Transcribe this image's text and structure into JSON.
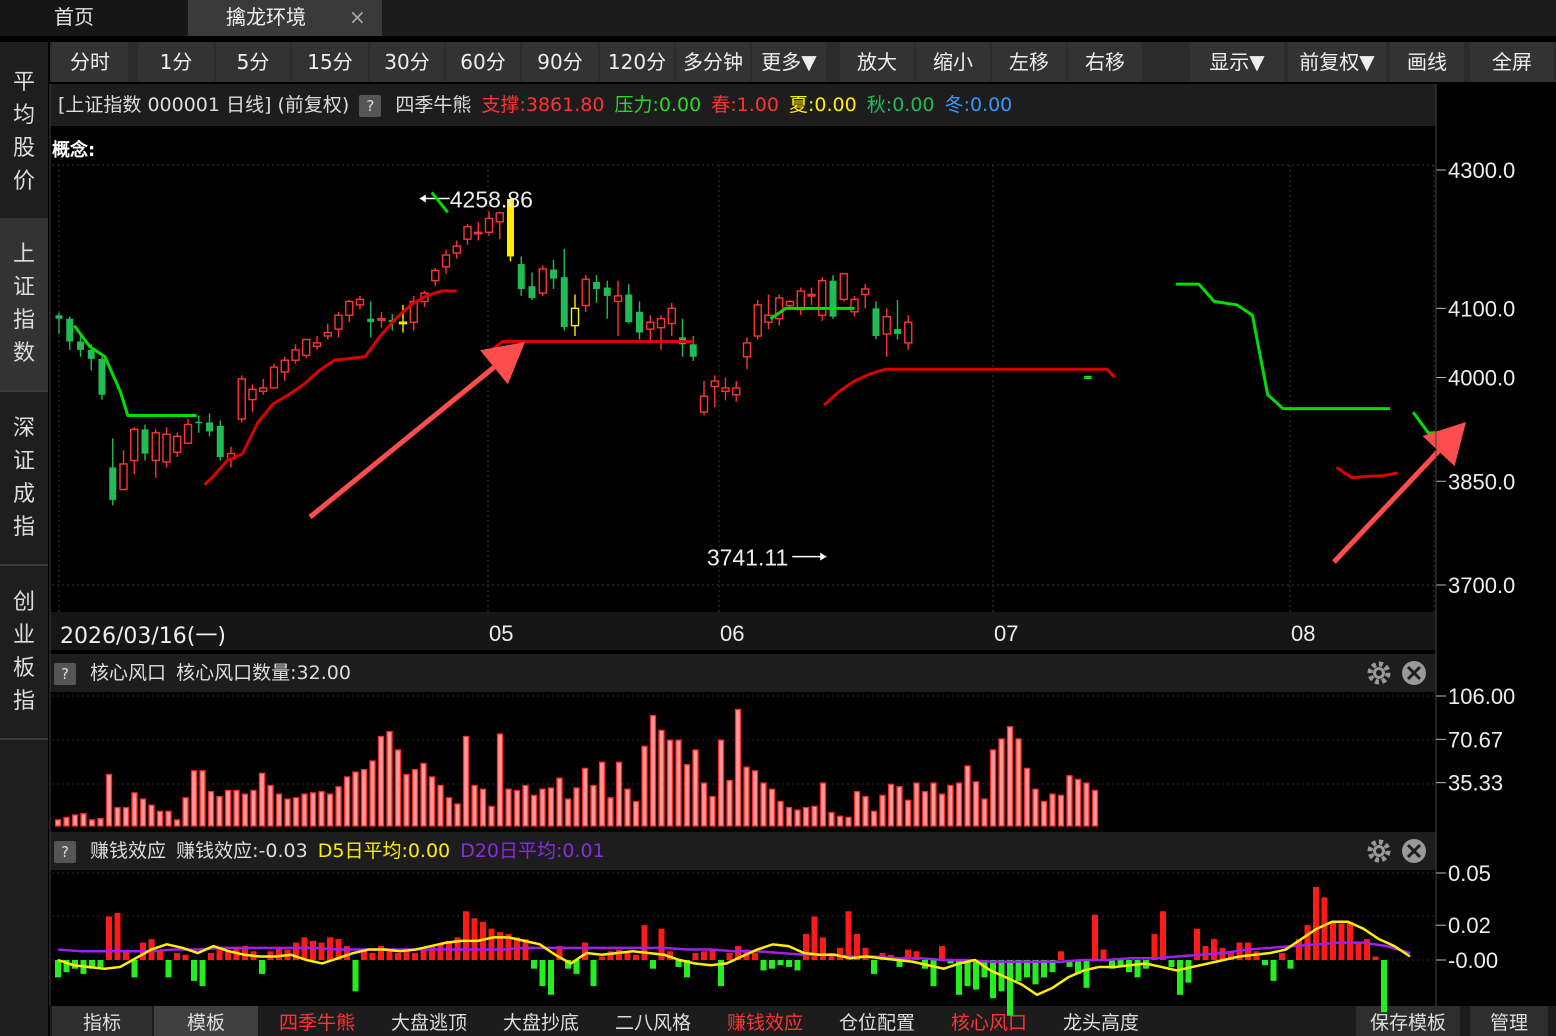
{
  "tabs": {
    "home": "首页",
    "env": "擒龙环境",
    "close": "×"
  },
  "toolbar": [
    "分时",
    "1分",
    "5分",
    "15分",
    "30分",
    "60分",
    "90分",
    "120分",
    "多分钟",
    "更多▼",
    "放大",
    "缩小",
    "左移",
    "右移",
    "显示▼",
    "前复权▼",
    "画线",
    "全屏"
  ],
  "sidebar": [
    {
      "label": "平均股价",
      "active": false
    },
    {
      "label": "上证指数",
      "active": true
    },
    {
      "label": "深证成指",
      "active": false
    },
    {
      "label": "创业板指",
      "active": false
    }
  ],
  "info": {
    "title": "[上证指数 000001 日线] (前复权)",
    "help": "?",
    "indicator": "四季牛熊",
    "support": "支撑:3861.80",
    "pressure": "压力:0.00",
    "spring": "春:1.00",
    "summer": "夏:0.00",
    "autumn": "秋:0.00",
    "winter": "冬:0.00"
  },
  "concept_label": "概念:",
  "date_label": "2026/03/16(一)",
  "core_panel": {
    "help": "?",
    "name": "核心风口",
    "value": "核心风口数量:32.00"
  },
  "money_panel": {
    "help": "?",
    "name": "赚钱效应",
    "value": "赚钱效应:-0.03",
    "d5": "D5日平均:0.00",
    "d20": "D20日平均:0.01"
  },
  "bottom": [
    "指标",
    "模板",
    "四季牛熊",
    "大盘逃顶",
    "大盘抄底",
    "二八风格",
    "赚钱效应",
    "仓位配置",
    "核心风口",
    "龙头高度",
    "保存模板",
    "管理"
  ],
  "bottom_red": [
    2,
    6,
    8
  ],
  "colors": {
    "up": "#ff3333",
    "down": "#22bb55",
    "neutral": "#ffee00",
    "support": "#dd0000",
    "pressure": "#00dd00",
    "arrow": "#ff4d4d",
    "ma5": "#ffee00",
    "ma20": "#a020f0"
  },
  "chart_data": [
    {
      "type": "candlestick",
      "title": "上证指数 000001 日线",
      "x_tick_labels": [
        "05",
        "06",
        "07",
        "08"
      ],
      "x_tick_index": [
        27,
        42,
        60,
        80
      ],
      "y_ticks": [
        4300.0,
        4100.0,
        4000.0,
        3850.0,
        3700.0
      ],
      "y_tick_labels": [
        "4300.0",
        "4100.0",
        "4000.0",
        "3850.0",
        "3700.0"
      ],
      "ylim": [
        3700,
        4300
      ],
      "annotations": [
        {
          "text": "4258.86",
          "index": 33,
          "value": 4258.86
        },
        {
          "text": "3741.11",
          "index": 71,
          "value": 3741.11
        }
      ],
      "ohlc": [
        [
          4090,
          4094,
          4063,
          4085
        ],
        [
          4085,
          4088,
          4040,
          4052
        ],
        [
          4052,
          4062,
          4030,
          4040
        ],
        [
          4040,
          4048,
          4010,
          4027
        ],
        [
          4027,
          4030,
          3968,
          3975
        ],
        [
          3870,
          3912,
          3815,
          3823
        ],
        [
          3838,
          3895,
          3840,
          3875
        ],
        [
          3880,
          3928,
          3860,
          3925
        ],
        [
          3925,
          3932,
          3880,
          3890
        ],
        [
          3880,
          3925,
          3855,
          3920
        ],
        [
          3878,
          3928,
          3870,
          3918
        ],
        [
          3892,
          3920,
          3885,
          3915
        ],
        [
          3905,
          3940,
          3905,
          3932
        ],
        [
          3936,
          3945,
          3920,
          3935
        ],
        [
          3935,
          3948,
          3915,
          3922
        ],
        [
          3930,
          3938,
          3880,
          3885
        ],
        [
          3882,
          3900,
          3870,
          3890
        ],
        [
          3940,
          4003,
          3935,
          3998
        ],
        [
          3968,
          3990,
          3950,
          3983
        ],
        [
          3980,
          3998,
          3975,
          3985
        ],
        [
          3985,
          4020,
          3985,
          4015
        ],
        [
          4008,
          4030,
          3995,
          4025
        ],
        [
          4025,
          4048,
          4020,
          4040
        ],
        [
          4032,
          4055,
          4028,
          4055
        ],
        [
          4045,
          4060,
          4040,
          4050
        ],
        [
          4060,
          4078,
          4055,
          4065
        ],
        [
          4070,
          4095,
          4058,
          4090
        ],
        [
          4090,
          4112,
          4080,
          4110
        ],
        [
          4105,
          4118,
          4098,
          4113
        ],
        [
          4085,
          4110,
          4058,
          4080
        ],
        [
          4083,
          4095,
          4072,
          4085
        ],
        [
          4083,
          4092,
          4068,
          4080
        ],
        [
          4078,
          4105,
          4065,
          4080
        ],
        [
          4080,
          4118,
          4068,
          4110
        ],
        [
          4110,
          4125,
          4102,
          4122
        ],
        [
          4140,
          4158,
          4132,
          4155
        ],
        [
          4160,
          4185,
          4150,
          4177
        ],
        [
          4180,
          4198,
          4172,
          4190
        ],
        [
          4200,
          4222,
          4192,
          4218
        ],
        [
          4208,
          4225,
          4198,
          4210
        ],
        [
          4210,
          4240,
          4205,
          4230
        ],
        [
          4225,
          4240,
          4200,
          4238
        ],
        [
          4258,
          4258.86,
          4168,
          4175
        ],
        [
          4164,
          4175,
          4118,
          4128
        ],
        [
          4132,
          4152,
          4112,
          4115
        ],
        [
          4122,
          4162,
          4118,
          4157
        ],
        [
          4156,
          4170,
          4128,
          4143
        ],
        [
          4145,
          4186,
          4068,
          4073
        ],
        [
          4075,
          4120,
          4060,
          4100
        ],
        [
          4104,
          4148,
          4095,
          4142
        ],
        [
          4138,
          4148,
          4108,
          4128
        ],
        [
          4130,
          4140,
          4085,
          4118
        ],
        [
          4110,
          4140,
          4060,
          4118
        ],
        [
          4120,
          4135,
          4078,
          4080
        ],
        [
          4095,
          4110,
          4055,
          4065
        ],
        [
          4070,
          4090,
          4050,
          4080
        ],
        [
          4072,
          4090,
          4040,
          4085
        ],
        [
          4078,
          4108,
          4060,
          4100
        ],
        [
          4058,
          4085,
          4030,
          4048
        ],
        [
          4048,
          4060,
          4024,
          4030
        ],
        [
          3950,
          3995,
          3945,
          3973
        ],
        [
          3987,
          4003,
          3957,
          3995
        ],
        [
          3980,
          4000,
          3967,
          3985
        ],
        [
          3975,
          3995,
          3965,
          3985
        ],
        [
          4030,
          4058,
          4012,
          4050
        ],
        [
          4060,
          4112,
          4055,
          4105
        ],
        [
          4080,
          4120,
          4070,
          4090
        ],
        [
          4085,
          4120,
          4075,
          4115
        ],
        [
          4104,
          4112,
          4098,
          4110
        ],
        [
          4098,
          4130,
          4090,
          4125
        ],
        [
          4118,
          4130,
          4105,
          4120
        ],
        [
          4090,
          4145,
          4082,
          4140
        ],
        [
          4140,
          4148,
          4085,
          4088
        ],
        [
          4113,
          4150,
          4110,
          4150
        ],
        [
          4095,
          4118,
          4088,
          4113
        ],
        [
          4120,
          4135,
          4100,
          4128
        ],
        [
          4100,
          4110,
          4055,
          4060
        ],
        [
          4063,
          4100,
          4030,
          4088
        ],
        [
          4070,
          4112,
          4055,
          4063
        ],
        [
          4050,
          4090,
          4040,
          4080
        ]
      ]
    },
    {
      "type": "bar",
      "title": "核心风口",
      "y_ticks": [
        106.0,
        70.67,
        35.33
      ],
      "y_tick_labels": [
        "106.00",
        "70.67",
        "35.33"
      ],
      "ylim": [
        0,
        106
      ],
      "values": [
        5,
        7,
        9,
        10,
        5,
        6,
        42,
        15,
        15,
        27,
        22,
        17,
        12,
        12,
        5,
        23,
        45,
        45,
        28,
        24,
        29,
        29,
        26,
        29,
        43,
        33,
        26,
        22,
        23,
        26,
        27,
        28,
        26,
        32,
        40,
        44,
        46,
        53,
        73,
        77,
        62,
        42,
        46,
        51,
        40,
        33,
        23,
        18,
        73,
        33,
        30,
        16,
        75,
        30,
        29,
        33,
        25,
        30,
        31,
        39,
        22,
        31,
        47,
        33,
        52,
        23,
        52,
        30,
        20,
        65,
        90,
        78,
        70,
        70,
        50,
        62,
        35,
        24,
        70,
        37,
        95,
        48,
        45,
        35,
        30,
        20,
        15,
        13,
        15,
        16,
        35,
        11,
        8,
        7,
        28,
        24,
        12,
        25,
        34,
        32,
        21,
        35,
        28,
        35,
        26,
        33,
        35,
        49,
        36,
        22,
        62,
        71,
        81,
        71,
        47,
        30,
        20,
        26,
        25,
        41,
        38,
        35,
        29
      ]
    },
    {
      "type": "bar",
      "title": "赚钱效应",
      "y_ticks": [
        0.05,
        0.02,
        0.0
      ],
      "y_tick_labels": [
        "0.05",
        "0.02",
        "-0.00"
      ],
      "ylim": [
        -0.055,
        0.06
      ],
      "series": [
        {
          "name": "赚钱效应",
          "type": "bar",
          "values": [
            -0.01,
            -0.007,
            -0.005,
            -0.008,
            -0.005,
            -0.004,
            0.025,
            0.027,
            0.005,
            -0.01,
            0.01,
            0.012,
            0.006,
            -0.01,
            0.004,
            0.003,
            -0.012,
            -0.015,
            0.004,
            0.006,
            0.005,
            0.007,
            0.008,
            0.005,
            -0.008,
            0.005,
            0.007,
            0.006,
            0.01,
            0.013,
            0.011,
            0.01,
            0.013,
            0.012,
            0.008,
            -0.018,
            0.006,
            0.004,
            0.008,
            0.006,
            0.004,
            0.005,
            0.004,
            0.006,
            0.008,
            0.009,
            0.011,
            0.013,
            0.028,
            0.024,
            0.022,
            0.018,
            0.016,
            0.015,
            0.013,
            0.012,
            -0.005,
            -0.015,
            -0.02,
            0.008,
            -0.005,
            -0.008,
            0.01,
            -0.015,
            0.002,
            0.005,
            0.006,
            0.004,
            0.003,
            0.02,
            -0.005,
            0.018,
            0.005,
            -0.004,
            -0.01,
            0.004,
            0.005,
            0.006,
            -0.015,
            0.004,
            0.008,
            0.006,
            0.004,
            -0.006,
            -0.005,
            -0.003,
            -0.004,
            -0.006,
            0.015,
            0.025,
            0.013,
            0.004,
            0.007,
            0.028,
            0.015,
            0.007,
            -0.008,
            0.004,
            0.003,
            -0.004,
            0.006,
            0.005,
            -0.005,
            -0.015,
            0.008,
            -0.002,
            -0.02,
            -0.015,
            -0.017,
            -0.01,
            -0.022,
            -0.018,
            -0.032,
            -0.012,
            -0.01,
            -0.014,
            -0.01,
            -0.007,
            0.005,
            -0.004,
            -0.008,
            -0.016,
            0.026,
            0.006,
            -0.005,
            -0.003,
            -0.007,
            -0.01,
            -0.005,
            0.015,
            0.028,
            -0.004,
            -0.02,
            -0.013,
            0.018,
            0.008,
            0.012,
            0.007,
            0.005,
            0.01,
            0.01,
            0.005,
            -0.003,
            -0.012,
            0.004,
            -0.005,
            0.012,
            0.02,
            0.042,
            0.036,
            0.022,
            0.021,
            0.022,
            0.01,
            0.012,
            0.002,
            -0.03
          ]
        },
        {
          "name": "D5日平均",
          "type": "line",
          "values": [
            0.0,
            -0.003,
            -0.004,
            -0.005,
            -0.004,
            0.001,
            0.006,
            0.009,
            0.007,
            0.004,
            0.008,
            0.005,
            0.003,
            0.002,
            0.002,
            0.003,
            0.0,
            -0.002,
            0.001,
            0.004,
            0.006,
            0.006,
            0.005,
            0.006,
            0.008,
            0.01,
            0.011,
            0.011,
            0.013,
            0.013,
            0.011,
            0.009,
            0.003,
            -0.002,
            0.004,
            0.003,
            0.004,
            0.005,
            0.004,
            0.003,
            0.0,
            -0.002,
            -0.003,
            -0.002,
            0.002,
            0.006,
            0.009,
            0.008,
            0.004,
            0.003,
            0.003,
            0.001,
            0.002,
            0.001,
            0.0,
            -0.001,
            -0.003,
            -0.005,
            -0.002,
            0.0,
            -0.006,
            -0.01,
            -0.014,
            -0.02,
            -0.016,
            -0.01,
            -0.006,
            -0.004,
            -0.004,
            -0.003,
            -0.002,
            -0.004,
            -0.006,
            -0.004,
            -0.002,
            0.0,
            0.002,
            0.003,
            0.004,
            0.006,
            0.012,
            0.018,
            0.022,
            0.022,
            0.018,
            0.012,
            0.008,
            0.002
          ]
        },
        {
          "name": "D20日平均",
          "type": "line",
          "values": [
            0.006,
            0.005,
            0.005,
            0.005,
            0.005,
            0.006,
            0.006,
            0.007,
            0.007,
            0.007,
            0.007,
            0.007,
            0.006,
            0.006,
            0.006,
            0.006,
            0.006,
            0.006,
            0.006,
            0.006,
            0.007,
            0.007,
            0.007,
            0.007,
            0.007,
            0.007,
            0.007,
            0.006,
            0.006,
            0.005,
            0.005,
            0.004,
            0.003,
            0.003,
            0.002,
            0.002,
            0.001,
            0.001,
            0.0,
            0.0,
            -0.001,
            -0.001,
            -0.001,
            -0.001,
            0.0,
            0.0,
            0.001,
            0.001,
            0.002,
            0.003,
            0.004,
            0.006,
            0.007,
            0.008,
            0.009,
            0.01,
            0.01,
            0.008,
            0.004
          ]
        }
      ]
    }
  ]
}
